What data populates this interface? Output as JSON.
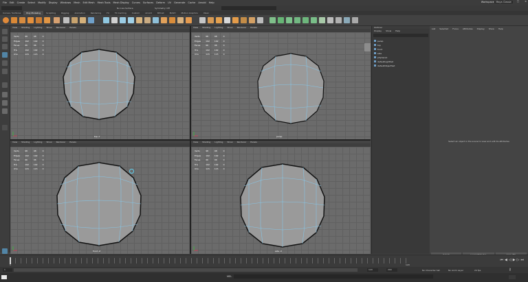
{
  "window": {
    "menu": [
      "File",
      "Edit",
      "Create",
      "Select",
      "Modify",
      "Display",
      "Windows",
      "Mesh",
      "Edit Mesh",
      "Mesh Tools",
      "Mesh Display",
      "Curves",
      "Surfaces",
      "Deform",
      "UV",
      "Generate",
      "Cache",
      "Arnold",
      "Help"
    ],
    "workspace_label": "Workspace:",
    "workspace_value": "Maya Classic"
  },
  "status_line": {
    "no_live_surface": "No Live Surface",
    "symmetry": "Symmetry: Off"
  },
  "shelf_tabs": [
    "Curves / Surfaces",
    "Poly Modeling",
    "Sculpting",
    "Rigging",
    "Animation",
    "Rendering",
    "FX",
    "FX Caching",
    "Custom",
    "Arnold",
    "Bifrost",
    "MASH",
    "Motion Graphics",
    "XGen"
  ],
  "shelf_active": "Poly Modeling",
  "viewport_menu": [
    "View",
    "Shading",
    "Lighting",
    "Show",
    "Renderer",
    "Panels"
  ],
  "hud": {
    "rows": [
      {
        "label": "Verts",
        "a": "98",
        "b": "98",
        "c": "0"
      },
      {
        "label": "Edges",
        "a": "192",
        "b": "192",
        "c": "0"
      },
      {
        "label": "Faces",
        "a": "96",
        "b": "96",
        "c": "0"
      },
      {
        "label": "Tris",
        "a": "192",
        "b": "192",
        "c": "0"
      },
      {
        "label": "UVs",
        "a": "115",
        "b": "115",
        "c": "0"
      }
    ]
  },
  "viewports": [
    {
      "label": "top -Y"
    },
    {
      "label": "persp"
    },
    {
      "label": "front -Z"
    },
    {
      "label": "side -X"
    }
  ],
  "outliner": {
    "title": "Outliner",
    "menu": [
      "Display",
      "Show",
      "Help"
    ],
    "items": [
      "persp",
      "top",
      "front",
      "side",
      "pSphere1",
      "defaultLightSet",
      "defaultObjectSet"
    ]
  },
  "attribute_editor": {
    "menu": [
      "List",
      "Selected",
      "Focus",
      "Attributes",
      "Display",
      "Show",
      "Help"
    ],
    "message": "Select an object in the scene to view and edit its attributes",
    "buttons": [
      "Select",
      "Load Attributes",
      "Copy Tab"
    ]
  },
  "timeline": {
    "start": "1",
    "end": "120",
    "range_start": "1",
    "range_end": "120",
    "anim_end": "200",
    "no_character_set": "No Character Set",
    "no_anim_layer": "No Anim Layer",
    "fps": "24 fps"
  },
  "command_line": {
    "mel_label": "MEL"
  },
  "colors": {
    "sphere": "#9a9a9a",
    "wire": "#86c5e6",
    "accent": "#5285a6"
  }
}
